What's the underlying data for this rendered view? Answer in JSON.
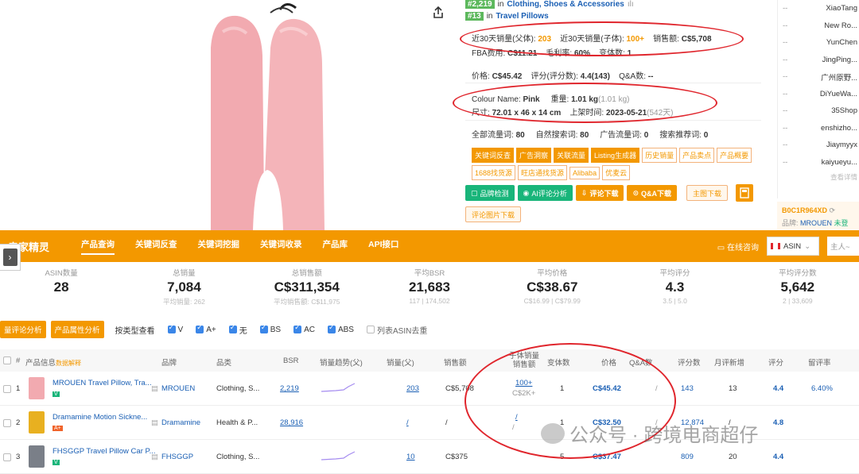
{
  "ranks": [
    {
      "rank": "#2,219",
      "in": "in",
      "category": "Clothing, Shoes & Accessories"
    },
    {
      "rank": "#13",
      "in": "in",
      "category": "Travel Pillows"
    }
  ],
  "metrics": {
    "sales30_parent_label": "近30天销量(父体):",
    "sales30_parent": "203",
    "sales30_child_label": "近30天销量(子体):",
    "sales30_child": "100+",
    "revenue_label": "销售额:",
    "revenue": "C$5,708",
    "fba_label": "FBA费用:",
    "fba": "C$11.21",
    "margin_label": "毛利率:",
    "margin": "60%",
    "variants_label": "变体数:",
    "variants": "1",
    "price_label": "价格:",
    "price": "C$45.42",
    "rating_label": "评分(评分数):",
    "rating": "4.4(143)",
    "qa_label": "Q&A数:",
    "qa": "--",
    "colour_label": "Colour Name:",
    "colour": "Pink",
    "weight_label": "重量:",
    "weight": "1.01 kg",
    "weight_paren": "(1.01 kg)",
    "size_label": "尺寸:",
    "size": "72.01 x 46 x 14 cm",
    "launch_label": "上架时间:",
    "launch": "2023-05-21",
    "launch_days": "(542天)",
    "traffic_all_label": "全部流量词:",
    "traffic_all": "80",
    "traffic_nat_label": "自然搜索词:",
    "traffic_nat": "80",
    "traffic_ad_label": "广告流量词:",
    "traffic_ad": "0",
    "traffic_rec_label": "搜索推荐词:",
    "traffic_rec": "0"
  },
  "tags_row1": [
    {
      "label": "关键词反查",
      "filled": true
    },
    {
      "label": "广告洞察",
      "filled": true
    },
    {
      "label": "关联流量",
      "filled": true
    },
    {
      "label": "Listing生成器",
      "filled": true
    },
    {
      "label": "历史销量",
      "filled": false
    },
    {
      "label": "产品卖点",
      "filled": false
    },
    {
      "label": "产品概要",
      "filled": false
    }
  ],
  "tags_row2": [
    "1688找货源",
    "旺店通找货源",
    "Alibaba",
    "优麦云"
  ],
  "action_buttons": [
    {
      "label": "品牌检测",
      "style": "green"
    },
    {
      "label": "AI评论分析",
      "style": "green"
    },
    {
      "label": "评论下载",
      "style": "orange"
    },
    {
      "label": "Q&A下载",
      "style": "orange"
    },
    {
      "label": "主图下载",
      "style": "outline"
    }
  ],
  "review_img_download": "评论图片下载",
  "sidebar_names": [
    "XiaoTang",
    "New Ro...",
    "YunChen",
    "JingPing...",
    "广州原野...",
    "DiYueWa...",
    "35Shop",
    "enshizho...",
    "Jiaymyyx",
    "kaiyueyu..."
  ],
  "sidebar_more": "查看详情",
  "sidebar_asin": "B0C1R964XD",
  "sidebar_brand_label": "品牌:",
  "sidebar_brand": "MROUEN",
  "sidebar_brand_extra": "未登",
  "nav": {
    "logo": "卖家精灵",
    "items": [
      "产品查询",
      "关键词反查",
      "关键词挖掘",
      "关键词收录",
      "产品库",
      "API接口"
    ],
    "online_consult": "在线咨询",
    "site": "ASIN",
    "search_placeholder": "主人~"
  },
  "stats": [
    {
      "label": "ASIN数量",
      "value": "28",
      "sub": ""
    },
    {
      "label": "总销量",
      "value": "7,084",
      "sub": "平均销量: 262"
    },
    {
      "label": "总销售额",
      "value": "C$311,354",
      "sub": "平均销售额: C$11,975"
    },
    {
      "label": "平均BSR",
      "value": "21,683",
      "sub": "117 | 174,502"
    },
    {
      "label": "平均价格",
      "value": "C$38.67",
      "sub": "C$16.99 | C$79.99"
    },
    {
      "label": "平均评分",
      "value": "4.3",
      "sub": "3.5 | 5.0"
    },
    {
      "label": "平均评分数",
      "value": "5,642",
      "sub": "2 | 33,609"
    }
  ],
  "filters": {
    "btn1": "量评论分析",
    "btn2": "产品属性分析",
    "type_label": "按类型查看",
    "checks": [
      "V",
      "A+",
      "无",
      "BS",
      "AC",
      "ABS"
    ],
    "dedupe": "列表ASIN去重"
  },
  "headers": {
    "idx": "#",
    "product": "产品信息",
    "product_extra": "数据解释",
    "brand": "品牌",
    "category": "品类",
    "bsr": "BSR",
    "trend": "销量趋势(父)",
    "sales": "销量(父)",
    "revenue": "销售额",
    "child_sales": "子体销量",
    "child_revenue": "销售额",
    "variants": "变体数",
    "price": "价格",
    "qa": "Q&A数",
    "ratings": "评分数",
    "new_ratings": "月评新增",
    "rating": "评分",
    "retention": "留评率"
  },
  "rows": [
    {
      "idx": "1",
      "title": "MROUEN Travel Pillow, Tra...",
      "badge": "V",
      "brand": "MROUEN",
      "category": "Clothing, S...",
      "bsr": "2,219",
      "sales": "203",
      "revenue": "C$5,708",
      "child_sales": "100+",
      "child_revenue": "C$2K+",
      "variants": "1",
      "price": "C$45.42",
      "qa": "/",
      "ratings": "143",
      "new_ratings": "13",
      "rating": "4.4",
      "retention": "6.40%"
    },
    {
      "idx": "2",
      "title": "Dramamine Motion Sickne...",
      "badge": "A+",
      "brand": "Dramamine",
      "category": "Health & P...",
      "bsr": "28,916",
      "sales": "/",
      "revenue": "/",
      "child_sales": "/",
      "child_revenue": "/",
      "variants": "1",
      "price": "C$32.50",
      "qa": "/",
      "ratings": "12,874",
      "new_ratings": "/",
      "rating": "4.8",
      "retention": ""
    },
    {
      "idx": "3",
      "title": "FHSGGP Travel Pillow Car P...",
      "badge": "V",
      "brand": "FHSGGP",
      "category": "Clothing, S...",
      "bsr": "",
      "sales": "10",
      "revenue": "C$375",
      "child_sales": "",
      "child_revenue": "",
      "variants": "5",
      "price": "C$37.47",
      "qa": "",
      "ratings": "809",
      "new_ratings": "20",
      "rating": "4.4",
      "retention": ""
    }
  ],
  "watermark": "公众号 · 跨境电商超仔",
  "colors": {
    "brand_orange": "#f39800",
    "highlight_red": "#e0262d",
    "link_blue": "#1a5fb4",
    "green": "#19b57a"
  }
}
